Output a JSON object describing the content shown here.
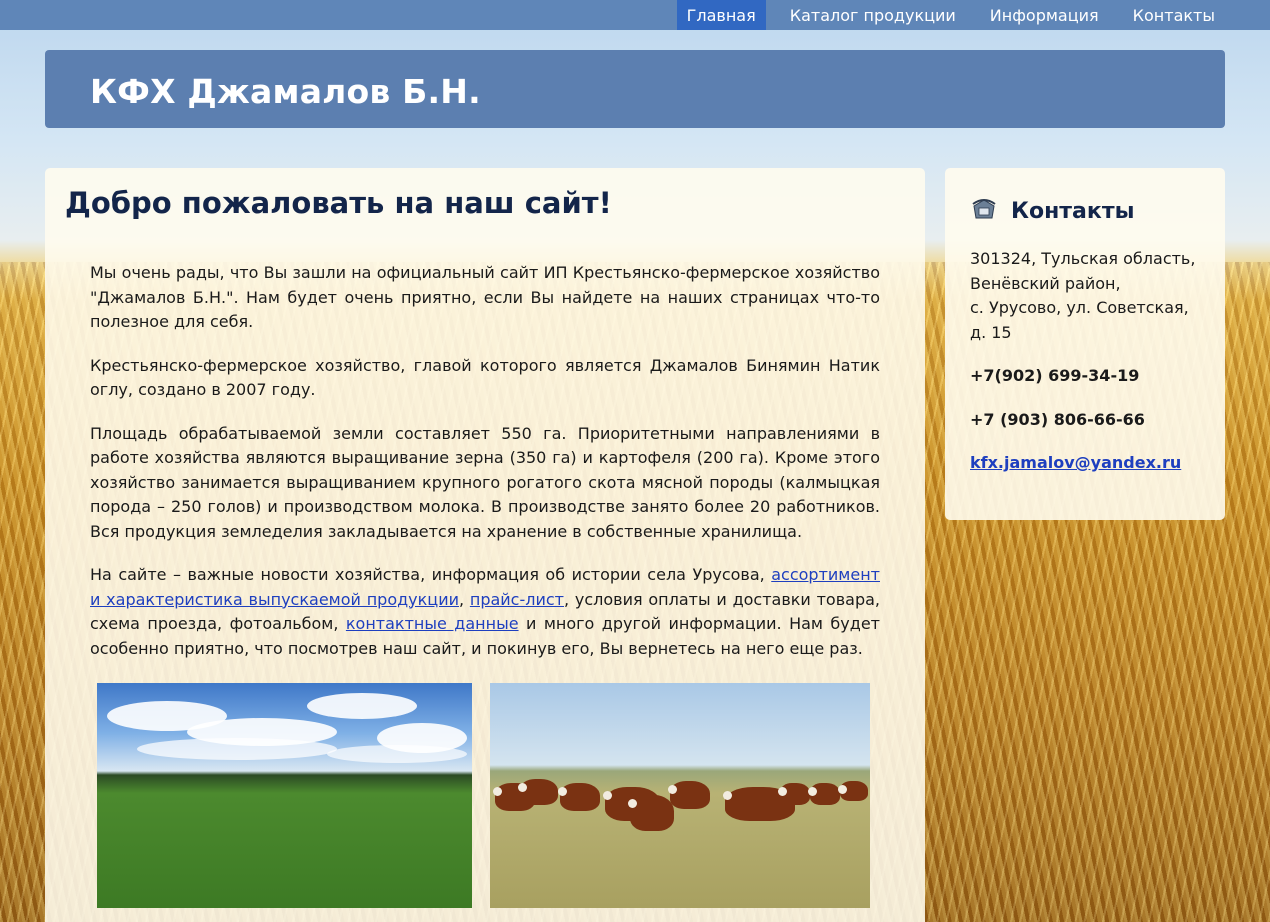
{
  "nav": {
    "items": [
      {
        "label": "Главная",
        "active": true
      },
      {
        "label": "Каталог продукции",
        "active": false
      },
      {
        "label": "Информация",
        "active": false
      },
      {
        "label": "Контакты",
        "active": false
      }
    ]
  },
  "header": {
    "title": "КФХ Джамалов Б.Н."
  },
  "main": {
    "heading": "Добро пожаловать на наш сайт!",
    "p1": "Мы очень рады, что Вы зашли на официальный сайт ИП Крестьянско-фермерское хозяйство \"Джамалов Б.Н.\". Нам будет очень приятно, если Вы найдете на наших страницах что-то полезное для себя.",
    "p2": "Крестьянско-фермерское хозяйство, главой которого является Джамалов Бинямин Натик оглу, создано в 2007 году.",
    "p3": "Площадь обрабатываемой земли составляет 550 га. Приоритетными направлениями в работе хозяйства являются выращивание зерна (350 га) и картофеля (200 га). Кроме этого хозяйство занимается выращиванием крупного рогатого скота мясной породы (калмыцкая порода – 250 голов) и производством молока. В производстве занято более 20 работников. Вся продукция земледелия закладывается на хранение в собственные хранилища.",
    "p4": {
      "t1": "На сайте – важные новости хозяйства, информация об истории села Урусова, ",
      "link1": "ассортимент и характеристика выпускаемой продукции",
      "t2": ", ",
      "link2": "прайс-лист",
      "t3": ", условия оплаты и доставки товара, схема проезда, фотоальбом, ",
      "link3": "контактные данные",
      "t4": " и много другой информации. Нам будет особенно приятно, что посмотрев наш сайт, и покинув его, Вы вернетесь на него еще раз."
    }
  },
  "sidebar": {
    "title": "Контакты",
    "icon": "telephone-icon",
    "address": [
      "301324, Тульская область,",
      "Венёвский район,",
      "с. Урусово, ул. Советская,",
      "д. 15"
    ],
    "phone1": "+7(902) 699-34-19",
    "phone2": "+7 (903) 806-66-66",
    "email": "kfx.jamalov@yandex.ru"
  },
  "colors": {
    "nav_bg": "#5f86b8",
    "nav_active": "#3168c2",
    "banner_bg": "#5c7fb0",
    "heading": "#13254a",
    "link": "#1e3fbf"
  }
}
